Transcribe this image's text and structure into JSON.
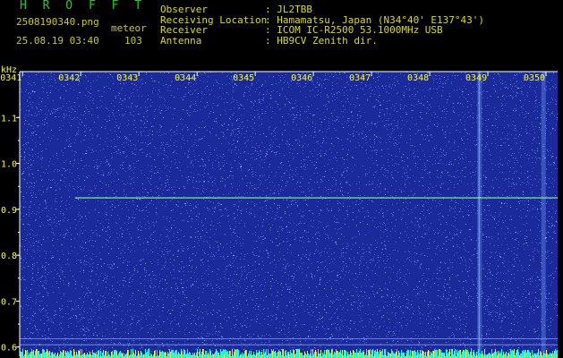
{
  "header": {
    "title": "H R O F F T",
    "filename": "2508190340.png",
    "detection_type": "meteor",
    "datetime": "25.08.19 03:40",
    "count": "103",
    "colors": {
      "title": "#22cc22",
      "info": "#cccc00",
      "meta": "#dddd00"
    }
  },
  "station": {
    "labels": [
      "Observer",
      "Receiving Location",
      "Receiver",
      "Antenna"
    ],
    "values": [
      ": JL2TBB",
      ": Hamamatsu, Japan (N34°40' E137°43')",
      ": ICOM IC-R2500 53.1000MHz USB",
      ": HB9CV Zenith dir."
    ]
  },
  "chart_data": {
    "type": "heatmap",
    "ylabel": "kHz",
    "y_ticks": [
      "1.1",
      "1.0",
      "0.9",
      "0.8",
      "0.7",
      "0.6"
    ],
    "y_tick_values": [
      1.1,
      1.0,
      0.9,
      0.8,
      0.7,
      0.6
    ],
    "ylim": [
      0.58,
      1.2
    ],
    "x_ticks": [
      "0341",
      "0342",
      "0343",
      "0344",
      "0345",
      "0346",
      "0347",
      "0348",
      "0349",
      "0350"
    ],
    "xlim_minutes": [
      40.95,
      50.2
    ],
    "carrier_khz": 0.925,
    "carrier_start_minute": 41.9,
    "extra_lines_khz": [
      0.618,
      0.605
    ],
    "bright_vertical_minutes": [
      48.85,
      49.95
    ],
    "colors": {
      "background": "#1a2a9a",
      "noise": "#5577ee",
      "signal": "#88ff88",
      "axis": "#ffffff",
      "tick_label": "#ffff00",
      "bottom_noise": "#00ffff"
    }
  }
}
